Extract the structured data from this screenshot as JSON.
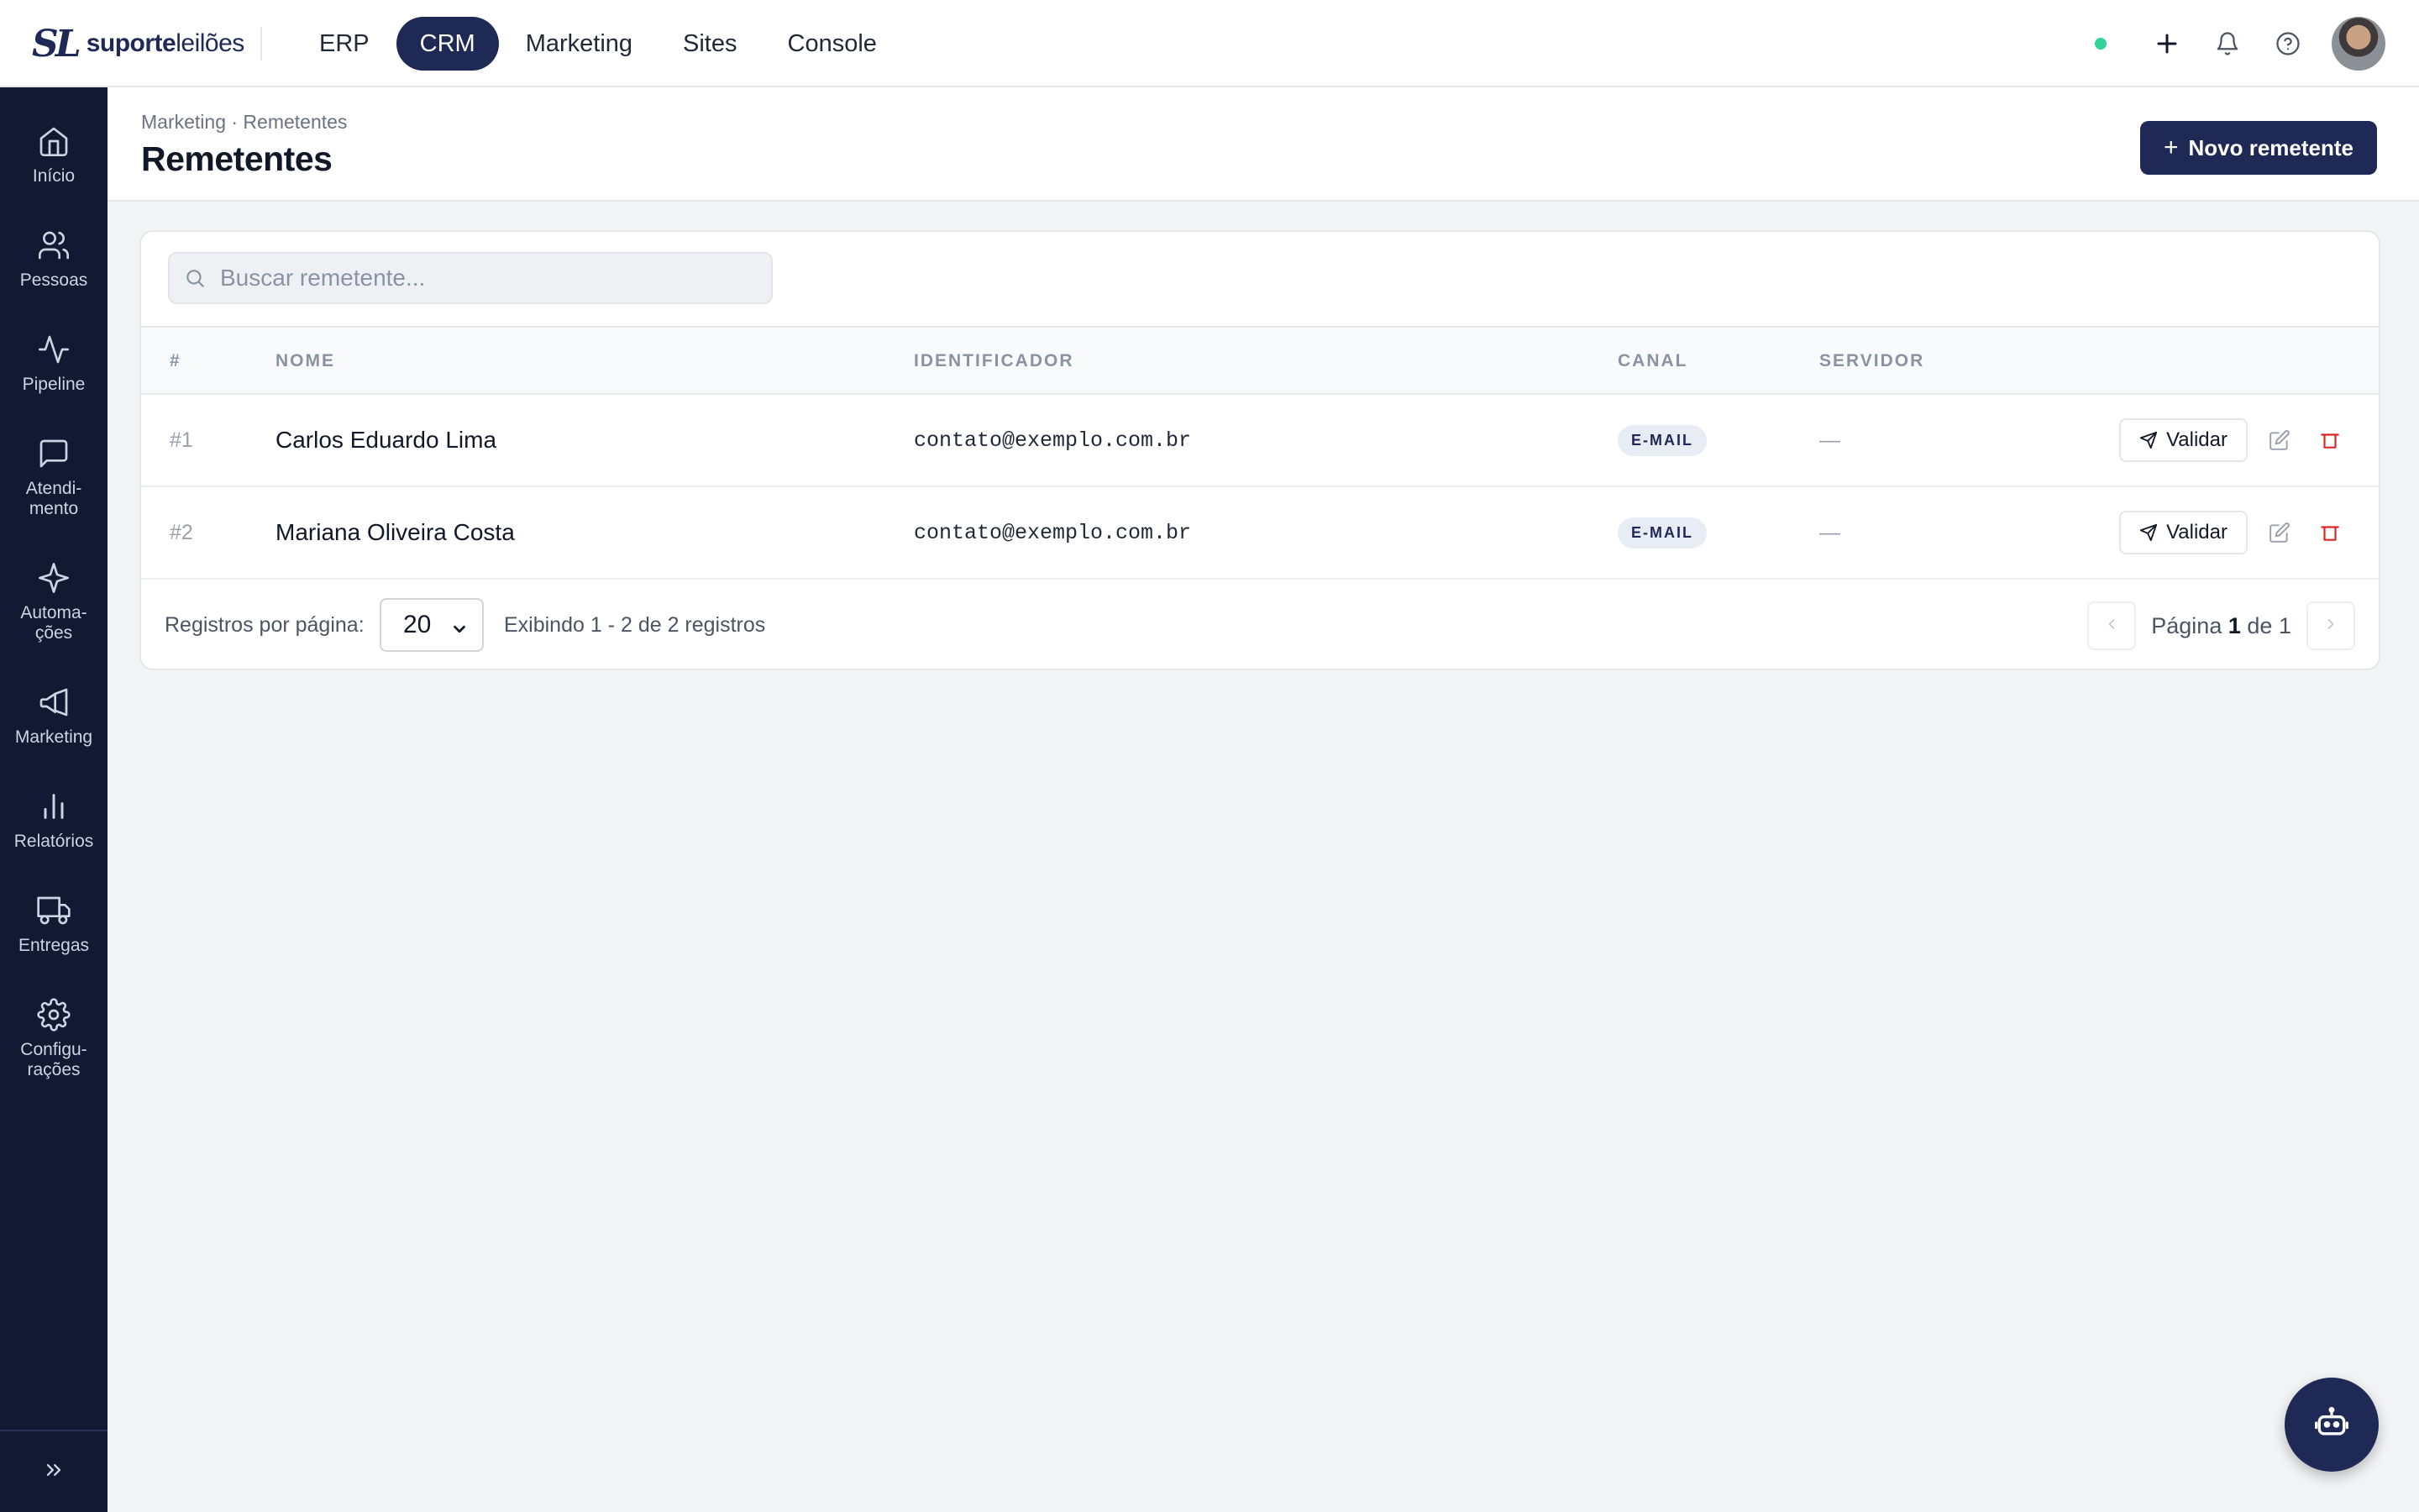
{
  "app": {
    "logo_mark": "SL",
    "logo_text_bold": "suporte",
    "logo_text_light": "leilões"
  },
  "topnav": {
    "tabs": [
      {
        "label": "ERP",
        "active": false
      },
      {
        "label": "CRM",
        "active": true
      },
      {
        "label": "Marketing",
        "active": false
      },
      {
        "label": "Sites",
        "active": false
      },
      {
        "label": "Console",
        "active": false
      }
    ],
    "status_color": "#34d399",
    "icons": [
      "plus-icon",
      "bell-icon",
      "help-icon"
    ]
  },
  "sidebar": {
    "items": [
      {
        "label": "Início",
        "icon": "home-icon"
      },
      {
        "label": "Pessoas",
        "icon": "users-icon"
      },
      {
        "label": "Pipeline",
        "icon": "activity-icon"
      },
      {
        "label": "Atendi-\nmento",
        "icon": "chat-icon"
      },
      {
        "label": "Automa-\nções",
        "icon": "sparkle-icon"
      },
      {
        "label": "Marketing",
        "icon": "megaphone-icon"
      },
      {
        "label": "Relatórios",
        "icon": "bar-chart-icon"
      },
      {
        "label": "Entregas",
        "icon": "truck-icon"
      },
      {
        "label": "Configu-\nrações",
        "icon": "gear-icon"
      }
    ],
    "collapse_icon": "chevrons-right-icon"
  },
  "header": {
    "breadcrumb": "Marketing · Remetentes",
    "title": "Remetentes",
    "new_button": "Novo remetente"
  },
  "search": {
    "placeholder": "Buscar remetente..."
  },
  "table": {
    "columns": [
      "#",
      "NOME",
      "IDENTIFICADOR",
      "CANAL",
      "SERVIDOR"
    ],
    "rows": [
      {
        "id": "#1",
        "nome": "Carlos Eduardo Lima",
        "identificador": "contato@exemplo.com.br",
        "canal": "E-MAIL",
        "servidor": "—",
        "action": "Validar"
      },
      {
        "id": "#2",
        "nome": "Mariana Oliveira Costa",
        "identificador": "contato@exemplo.com.br",
        "canal": "E-MAIL",
        "servidor": "—",
        "action": "Validar"
      }
    ]
  },
  "footer": {
    "per_page_label": "Registros por página:",
    "per_page_value": "20",
    "showing": "Exibindo 1 - 2 de 2 registros",
    "page_prefix": "Página",
    "page_current": "1",
    "page_of": "de",
    "page_total": "1"
  },
  "colors": {
    "brand": "#1e2a55",
    "sidebar_bg": "#121a33",
    "delete": "#dc2626"
  },
  "fab": {
    "icon": "bot-icon"
  }
}
